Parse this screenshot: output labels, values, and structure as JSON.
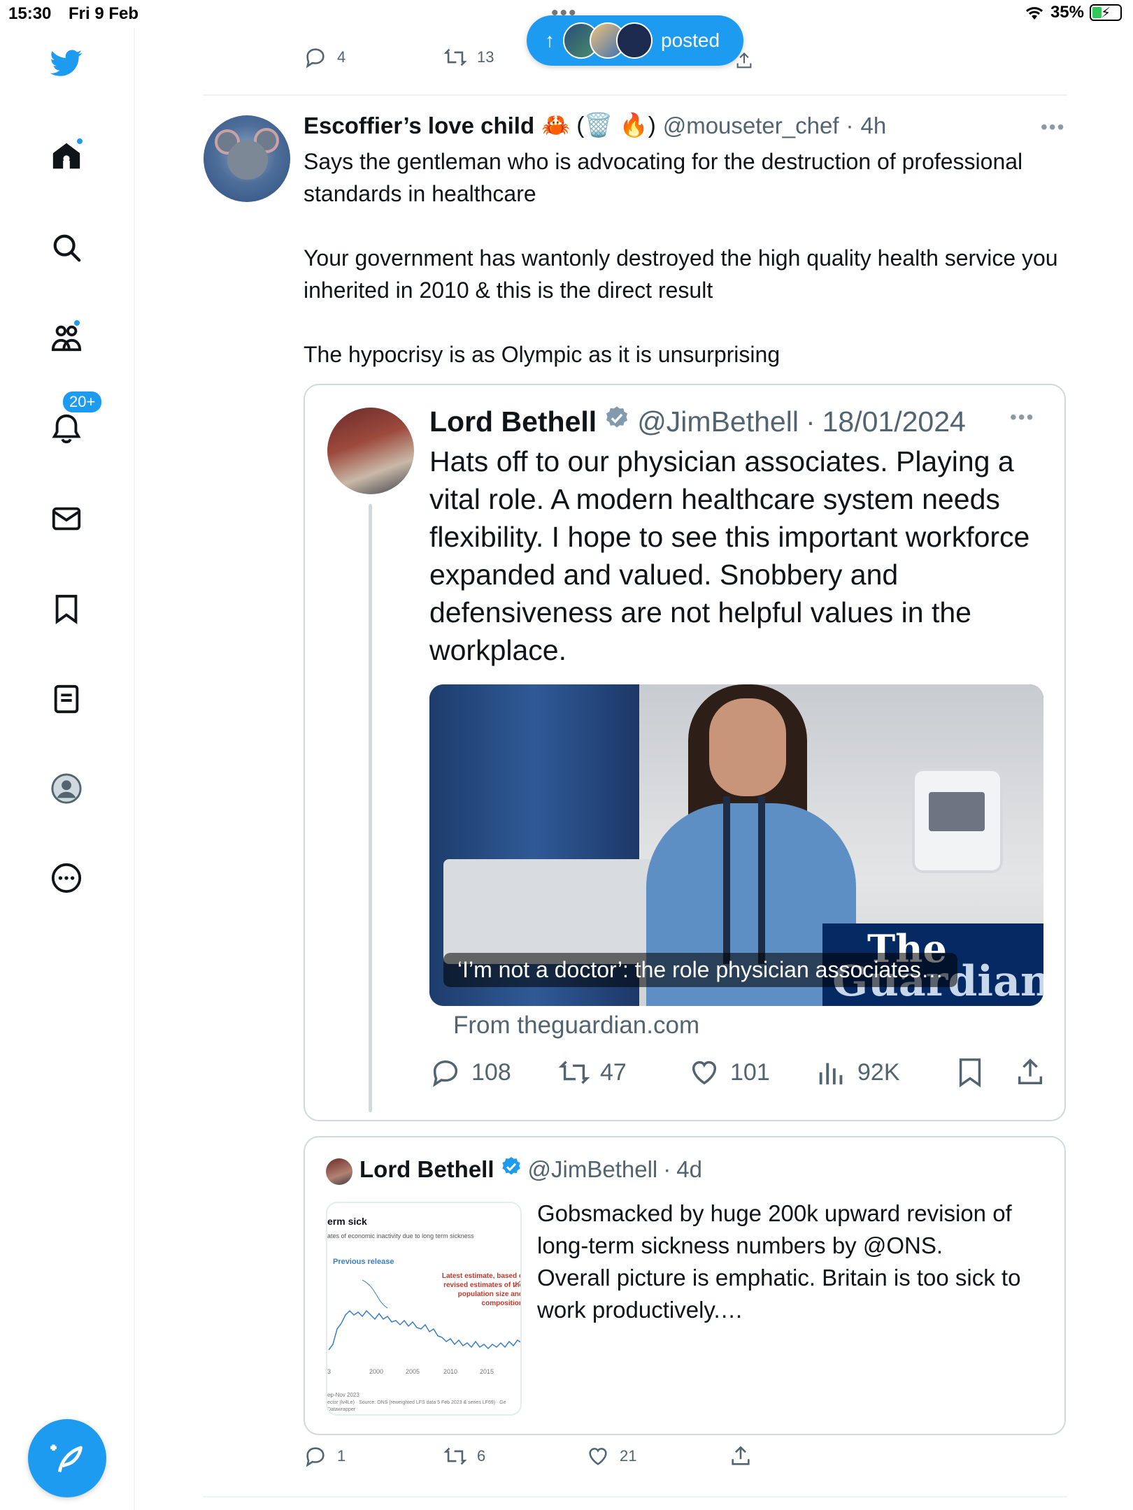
{
  "status_bar": {
    "time": "15:30",
    "date": "Fri 9 Feb",
    "battery": "35%",
    "battery_level": 0.35,
    "dots": "•••"
  },
  "sidebar": {
    "items": [
      {
        "name": "twitter-logo",
        "icon": "twitter-bird"
      },
      {
        "name": "home",
        "icon": "home",
        "has_dot": true
      },
      {
        "name": "search",
        "icon": "search"
      },
      {
        "name": "communities",
        "icon": "communities",
        "has_dot": true
      },
      {
        "name": "notifications",
        "icon": "bell",
        "badge": "20+"
      },
      {
        "name": "messages",
        "icon": "envelope"
      },
      {
        "name": "bookmarks",
        "icon": "bookmark"
      },
      {
        "name": "lists",
        "icon": "list"
      },
      {
        "name": "profile",
        "icon": "avatar"
      },
      {
        "name": "more",
        "icon": "more-circle"
      }
    ],
    "notifications_badge": "20+"
  },
  "prev_tweet_actions": {
    "replies": "4",
    "retweets": "13"
  },
  "posted_pill": {
    "label": "posted",
    "arrow": "↑"
  },
  "tweet": {
    "author_name": "Escoffier’s love child",
    "emojis": "🦀 (🗑️ 🔥)",
    "handle": "@mouseter_chef",
    "time": "4h",
    "separator": "·",
    "more": "•••",
    "body": "Says the gentleman who is advocating for the destruction of professional standards in healthcare\n\nYour government has wantonly destroyed the high quality health service you inherited in 2010 & this is the direct result\n\nThe hypocrisy is as Olympic as it is unsurprising",
    "actions": {
      "replies": "1",
      "retweets": "6",
      "likes": "21"
    }
  },
  "quoted_tweet": {
    "author_name": "Lord Bethell",
    "handle": "@JimBethell",
    "date": "18/01/2024",
    "separator": "·",
    "more": "•••",
    "text": "Hats off to our physician associates. Playing a vital role. A modern healthcare system needs flexibility. I hope to see this important workforce expanded and valued. Snobbery and defensiveness are not helpful values in the workplace.",
    "media_caption": "‘I’m not a doctor’: the role physician associates…",
    "media_logo_line1": "The",
    "media_logo_line2": "Guardian",
    "from_source": "From theguardian.com",
    "actions": {
      "replies": "108",
      "retweets": "47",
      "likes": "101",
      "views": "92K"
    }
  },
  "second_quote": {
    "author_name": "Lord Bethell",
    "handle": "@JimBethell",
    "time": "4d",
    "separator": "·",
    "text": "Gobsmacked by huge 200k upward revision of long-term sickness numbers by @ONS.\nOverall picture is emphatic. Britain is too sick to work productively.…",
    "thumbnail": {
      "title": "erm sick",
      "subtitle": "ates of economic inactivity due to long term sickness",
      "previous_label": "Previous release",
      "latest_label": "Latest estimate, based o revised estimates of the population size and composition",
      "years": [
        "2000",
        "2005",
        "2010",
        "2015"
      ],
      "year_start": "3",
      "footer1": "ep-Nov 2023",
      "footer2": "ector (lv4Le) · Source: ONS (reweighted LFS data 5 Feb 2023 & series LF69) · Ge",
      "footer3": "Datawrapper"
    }
  },
  "colors": {
    "accent": "#1d9bf0",
    "text": "#0f1419",
    "muted": "#536471",
    "border": "#cfd9de"
  }
}
